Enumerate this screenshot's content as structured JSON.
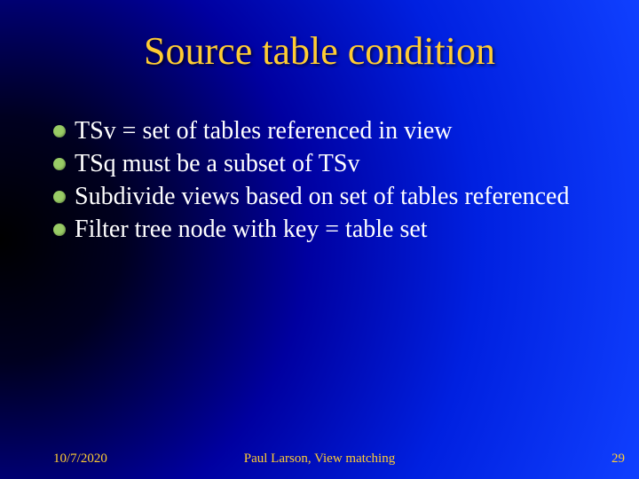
{
  "title": "Source table condition",
  "bullets": [
    "TSv = set of tables referenced in view",
    "TSq must be a subset of TSv",
    "Subdivide views based on set of tables referenced",
    "Filter tree node with key = table set"
  ],
  "footer": {
    "date": "10/7/2020",
    "author": "Paul Larson, View matching",
    "page": "29"
  }
}
